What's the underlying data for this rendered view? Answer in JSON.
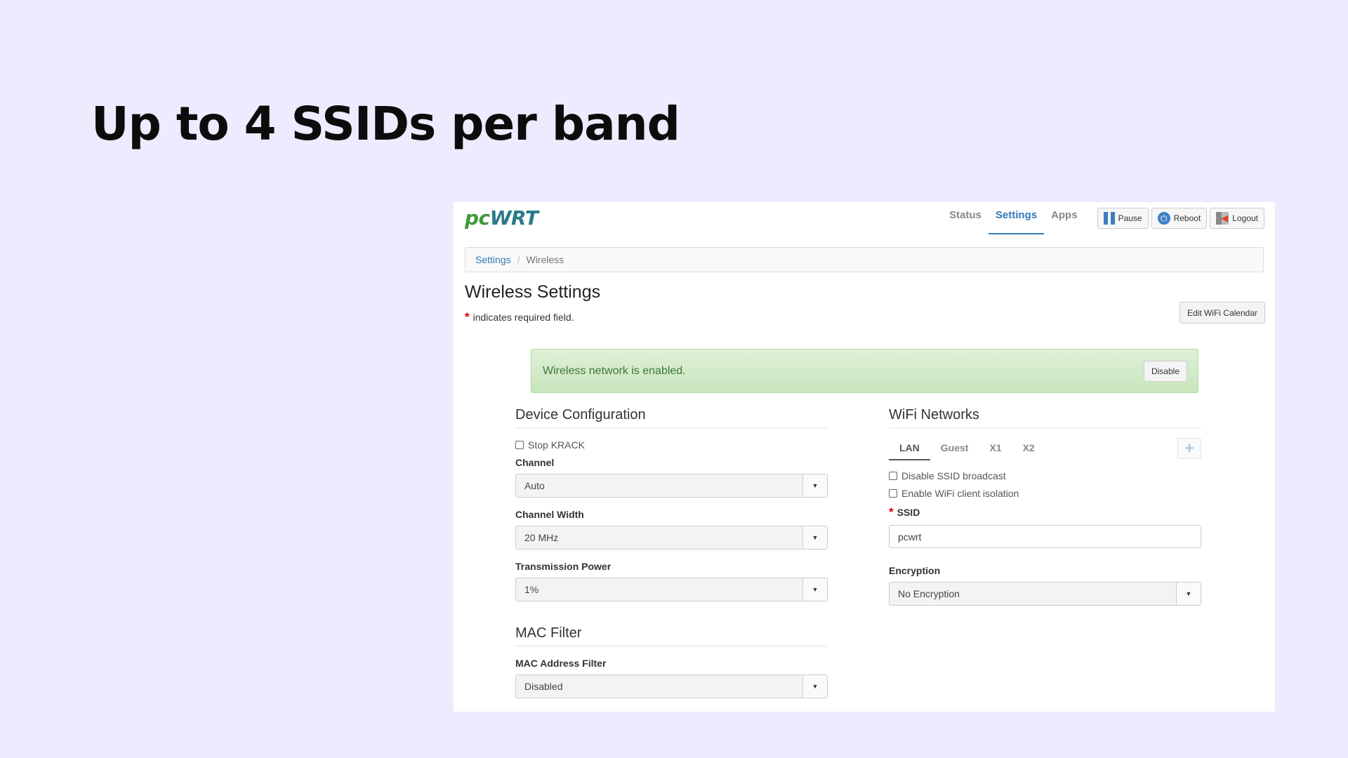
{
  "slide": {
    "title": "Up to 4 SSIDs per band"
  },
  "header": {
    "logo_pc": "pc",
    "logo_wrt": "WRT",
    "nav": [
      "Status",
      "Settings",
      "Apps"
    ],
    "active_nav": "Settings",
    "buttons": {
      "pause": "Pause",
      "reboot": "Reboot",
      "logout": "Logout"
    }
  },
  "breadcrumb": {
    "parent": "Settings",
    "separator": "/",
    "current": "Wireless"
  },
  "page": {
    "title": "Wireless Settings",
    "required_note": "indicates required field.",
    "required_mark": "*",
    "calendar_button": "Edit WiFi Calendar"
  },
  "alert": {
    "text": "Wireless network is enabled.",
    "button": "Disable"
  },
  "device_config": {
    "heading": "Device Configuration",
    "stop_krack": {
      "label": "Stop KRACK",
      "checked": false
    },
    "channel": {
      "label": "Channel",
      "value": "Auto"
    },
    "channel_width": {
      "label": "Channel Width",
      "value": "20 MHz"
    },
    "tx_power": {
      "label": "Transmission Power",
      "value": "1%"
    }
  },
  "mac_filter": {
    "heading": "MAC Filter",
    "filter": {
      "label": "MAC Address Filter",
      "value": "Disabled"
    }
  },
  "wifi": {
    "heading": "WiFi Networks",
    "tabs": [
      "LAN",
      "Guest",
      "X1",
      "X2"
    ],
    "active_tab": "LAN",
    "add_icon": "plus-icon",
    "disable_broadcast": {
      "label": "Disable SSID broadcast",
      "checked": false
    },
    "client_isolation": {
      "label": "Enable WiFi client isolation",
      "checked": false
    },
    "ssid": {
      "label": "SSID",
      "value": "pcwrt"
    },
    "encryption": {
      "label": "Encryption",
      "value": "No Encryption"
    }
  },
  "colors": {
    "accent": "#337ab7",
    "success_bg": "#dff0d8",
    "success_text": "#3c763d",
    "background": "#efeafd"
  }
}
